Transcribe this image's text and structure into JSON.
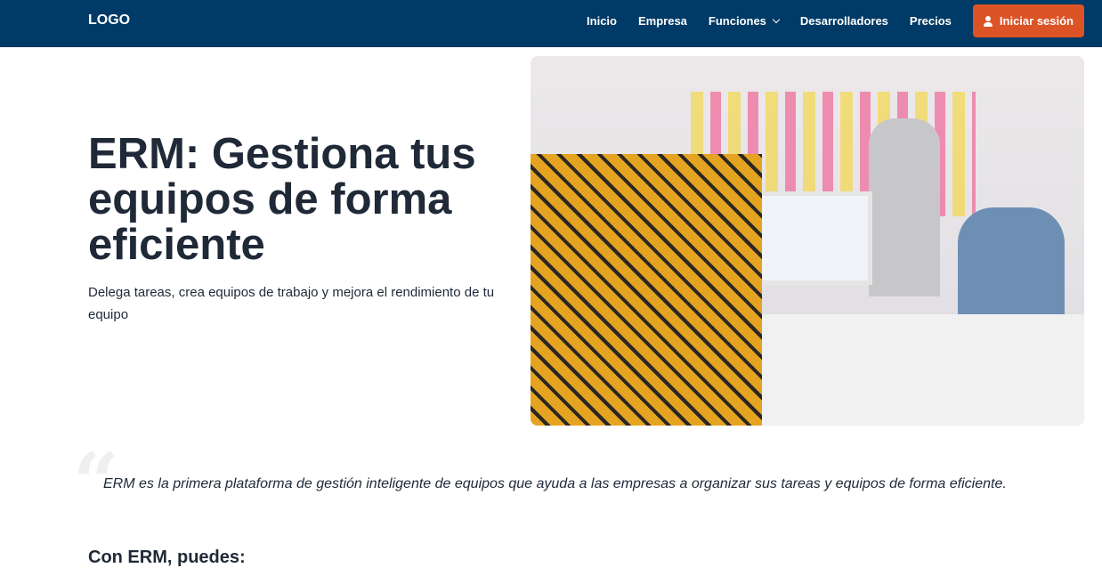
{
  "nav": {
    "logo": "LOGO",
    "items": [
      "Inicio",
      "Empresa",
      "Funciones",
      "Desarrolladores",
      "Precios"
    ],
    "login": "Iniciar sesión",
    "bg": "#003a66",
    "accent": "#dc5326"
  },
  "hero": {
    "title": "ERM: Gestiona tus equipos de forma eficiente",
    "subtitle": "Delega tareas, crea equipos de trabajo y mejora el rendimiento de tu equipo"
  },
  "quote": {
    "text": "ERM es la primera plataforma de gestión inteligente de equipos que ayuda a las empresas a organizar sus tareas y equipos de forma eficiente."
  },
  "section": {
    "heading": "Con ERM, puedes:"
  }
}
